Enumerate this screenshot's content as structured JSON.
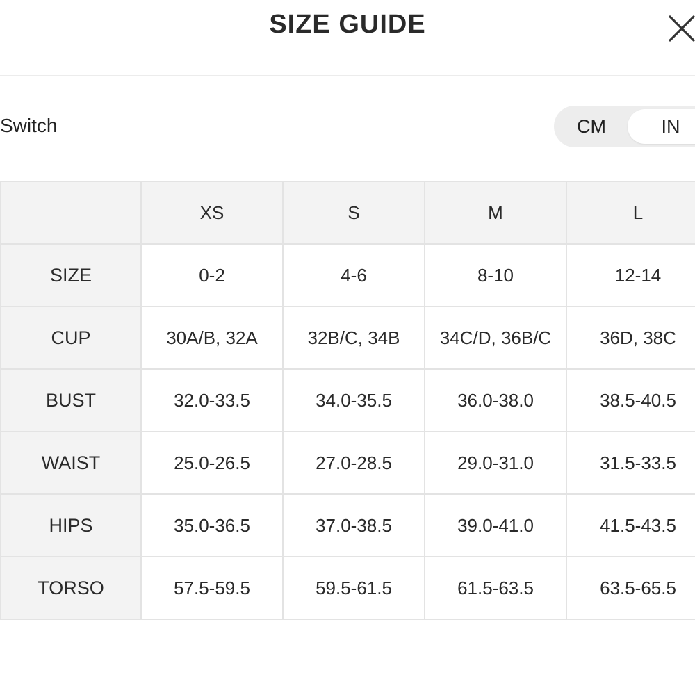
{
  "header": {
    "title": "SIZE GUIDE",
    "close_icon": "close-icon"
  },
  "unit_switch": {
    "label": "Switch",
    "options": [
      "CM",
      "IN"
    ],
    "selected": "IN"
  },
  "size_table": {
    "columns": [
      "XS",
      "S",
      "M",
      "L"
    ],
    "rows": [
      {
        "label": "SIZE",
        "values": [
          "0-2",
          "4-6",
          "8-10",
          "12-14"
        ]
      },
      {
        "label": "CUP",
        "values": [
          "30A/B, 32A",
          "32B/C, 34B",
          "34C/D, 36B/C",
          "36D, 38C"
        ]
      },
      {
        "label": "BUST",
        "values": [
          "32.0-33.5",
          "34.0-35.5",
          "36.0-38.0",
          "38.5-40.5"
        ]
      },
      {
        "label": "WAIST",
        "values": [
          "25.0-26.5",
          "27.0-28.5",
          "29.0-31.0",
          "31.5-33.5"
        ]
      },
      {
        "label": "HIPS",
        "values": [
          "35.0-36.5",
          "37.0-38.5",
          "39.0-41.0",
          "41.5-43.5"
        ]
      },
      {
        "label": "TORSO",
        "values": [
          "57.5-59.5",
          "59.5-61.5",
          "61.5-63.5",
          "63.5-65.5"
        ]
      }
    ]
  },
  "colors": {
    "header_cell_bg": "#f3f3f3",
    "border": "#e3e3e3",
    "toggle_bg": "#ededed",
    "text": "#2a2a2a"
  }
}
